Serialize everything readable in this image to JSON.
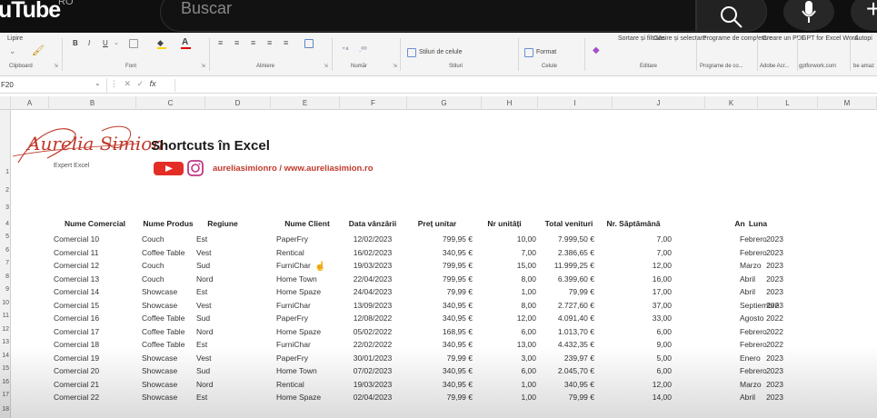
{
  "youtube": {
    "logo_text": "uTube",
    "country": "RO",
    "search_placeholder": "Buscar"
  },
  "ribbon": {
    "items": [
      "Lipire",
      "Stiluri de celule",
      "Format",
      "Sortare și filtrare",
      "Găsire și selectare",
      "Programe de completare",
      "Creare un PDF",
      "GPT for Excel Word",
      "Autopi"
    ],
    "groups": [
      "Clipboard",
      "Font",
      "Aliniere",
      "Număr",
      "Stiluri",
      "Celule",
      "Editare",
      "Programe de co...",
      "Adobe Acr...",
      "gptforwork.com",
      "be amaz"
    ]
  },
  "formula_bar": {
    "name_box": "F20",
    "fx": "fx"
  },
  "columns": [
    "A",
    "B",
    "C",
    "D",
    "E",
    "F",
    "G",
    "H",
    "I",
    "J",
    "K",
    "L",
    "M"
  ],
  "rows": [
    "1",
    "2",
    "3",
    "4",
    "5",
    "6",
    "7",
    "8",
    "9",
    "10",
    "11",
    "12",
    "13",
    "14",
    "15",
    "16",
    "17",
    "18"
  ],
  "logo": {
    "name": "Aurelia Simion",
    "subtitle": "Expert Excel"
  },
  "sheet": {
    "title": "Shortcuts în Excel",
    "social": "aureliasimionro / www.aureliasimion.ro",
    "headers": [
      "Nume Comercial",
      "Nume Produs",
      "Regiune",
      "Nume Client",
      "Data vânzării",
      "Preț unitar",
      "Nr unități",
      "Total venituri",
      "Nr. Săptămână",
      "An",
      "Luna"
    ],
    "data": [
      [
        "Comercial 10",
        "Couch",
        "Est",
        "PaperFry",
        "12/02/2023",
        "799,95 €",
        "10,00",
        "7.999,50 €",
        "7,00",
        "2023",
        "Febrero"
      ],
      [
        "Comercial 11",
        "Coffee Table",
        "Vest",
        "Rentical",
        "16/02/2023",
        "340,95 €",
        "7,00",
        "2.386,65 €",
        "7,00",
        "2023",
        "Febrero"
      ],
      [
        "Comercial 12",
        "Couch",
        "Sud",
        "FurniChar",
        "19/03/2023",
        "799,95 €",
        "15,00",
        "11.999,25 €",
        "12,00",
        "2023",
        "Marzo"
      ],
      [
        "Comercial 13",
        "Couch",
        "Nord",
        "Home Town",
        "22/04/2023",
        "799,95 €",
        "8,00",
        "6.399,60 €",
        "16,00",
        "2023",
        "Abril"
      ],
      [
        "Comercial 14",
        "Showcase",
        "Est",
        "Home Spaze",
        "24/04/2023",
        "79,99 €",
        "1,00",
        "79,99 €",
        "17,00",
        "2023",
        "Abril"
      ],
      [
        "Comercial 15",
        "Showcase",
        "Vest",
        "FurniChar",
        "13/09/2023",
        "340,95 €",
        "8,00",
        "2.727,60 €",
        "37,00",
        "2023",
        "Septiembre"
      ],
      [
        "Comercial 16",
        "Coffee Table",
        "Sud",
        "PaperFry",
        "12/08/2022",
        "340,95 €",
        "12,00",
        "4.091,40 €",
        "33,00",
        "2022",
        "Agosto"
      ],
      [
        "Comercial 17",
        "Coffee Table",
        "Nord",
        "Home Spaze",
        "05/02/2022",
        "168,95 €",
        "6,00",
        "1.013,70 €",
        "6,00",
        "2022",
        "Febrero"
      ],
      [
        "Comercial 18",
        "Coffee Table",
        "Est",
        "FurniChar",
        "22/02/2022",
        "340,95 €",
        "13,00",
        "4.432,35 €",
        "9,00",
        "2022",
        "Febrero"
      ],
      [
        "Comercial 19",
        "Showcase",
        "Vest",
        "PaperFry",
        "30/01/2023",
        "79,99 €",
        "3,00",
        "239,97 €",
        "5,00",
        "2023",
        "Enero"
      ],
      [
        "Comercial 20",
        "Showcase",
        "Sud",
        "Home Town",
        "07/02/2023",
        "340,95 €",
        "6,00",
        "2.045,70 €",
        "6,00",
        "2023",
        "Febrero"
      ],
      [
        "Comercial 21",
        "Showcase",
        "Nord",
        "Rentical",
        "19/03/2023",
        "340,95 €",
        "1,00",
        "340,95 €",
        "12,00",
        "2023",
        "Marzo"
      ],
      [
        "Comercial 22",
        "Showcase",
        "Est",
        "Home Spaze",
        "02/04/2023",
        "79,99 €",
        "1,00",
        "79,99 €",
        "14,00",
        "2023",
        "Abril"
      ]
    ]
  }
}
